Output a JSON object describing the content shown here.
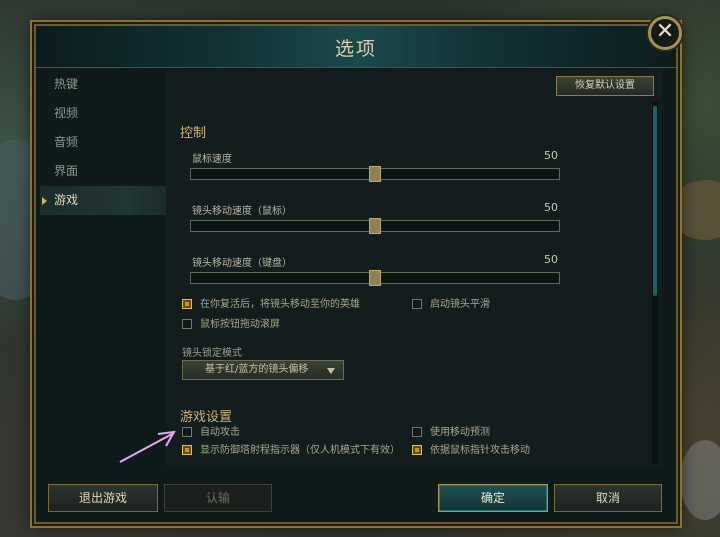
{
  "dialog": {
    "title": "选项",
    "close_glyph": "✕"
  },
  "sidebar": {
    "items": [
      {
        "label": "热键",
        "active": false
      },
      {
        "label": "视频",
        "active": false
      },
      {
        "label": "音频",
        "active": false
      },
      {
        "label": "界面",
        "active": false
      },
      {
        "label": "游戏",
        "active": true
      }
    ]
  },
  "content": {
    "restore_defaults_label": "恢复默认设置",
    "controls": {
      "title": "控制",
      "sliders": [
        {
          "label": "鼠标速度",
          "value": "50",
          "fraction": 0.5
        },
        {
          "label": "镜头移动速度（鼠标）",
          "value": "50",
          "fraction": 0.5
        },
        {
          "label": "镜头移动速度（键盘）",
          "value": "50",
          "fraction": 0.5
        }
      ],
      "checkboxes": [
        {
          "label": "在你复活后，将镜头移动至你的英雄",
          "checked": true
        },
        {
          "label": "启动镜头平滑",
          "checked": false
        },
        {
          "label": "鼠标按钮拖动滚屏",
          "checked": false
        }
      ],
      "camera_lock_label": "镜头锁定模式",
      "camera_lock_value": "基于红/蓝方的镜头偏移"
    },
    "game_settings": {
      "title": "游戏设置",
      "checkboxes": [
        {
          "label": "自动攻击",
          "checked": false
        },
        {
          "label": "使用移动预测",
          "checked": false
        },
        {
          "label": "显示防御塔射程指示器（仅人机模式下有效）",
          "checked": true
        },
        {
          "label": "依据鼠标指针攻击移动",
          "checked": true
        }
      ]
    }
  },
  "footer": {
    "quit_label": "退出游戏",
    "surrender_label": "认输",
    "ok_label": "确定",
    "cancel_label": "取消"
  },
  "colors": {
    "accent_gold": "#c89818",
    "accent_teal": "#1f5156"
  },
  "icons": {
    "close": "close-icon",
    "dropdown": "chevron-down-icon",
    "annotation": "arrow-icon"
  }
}
